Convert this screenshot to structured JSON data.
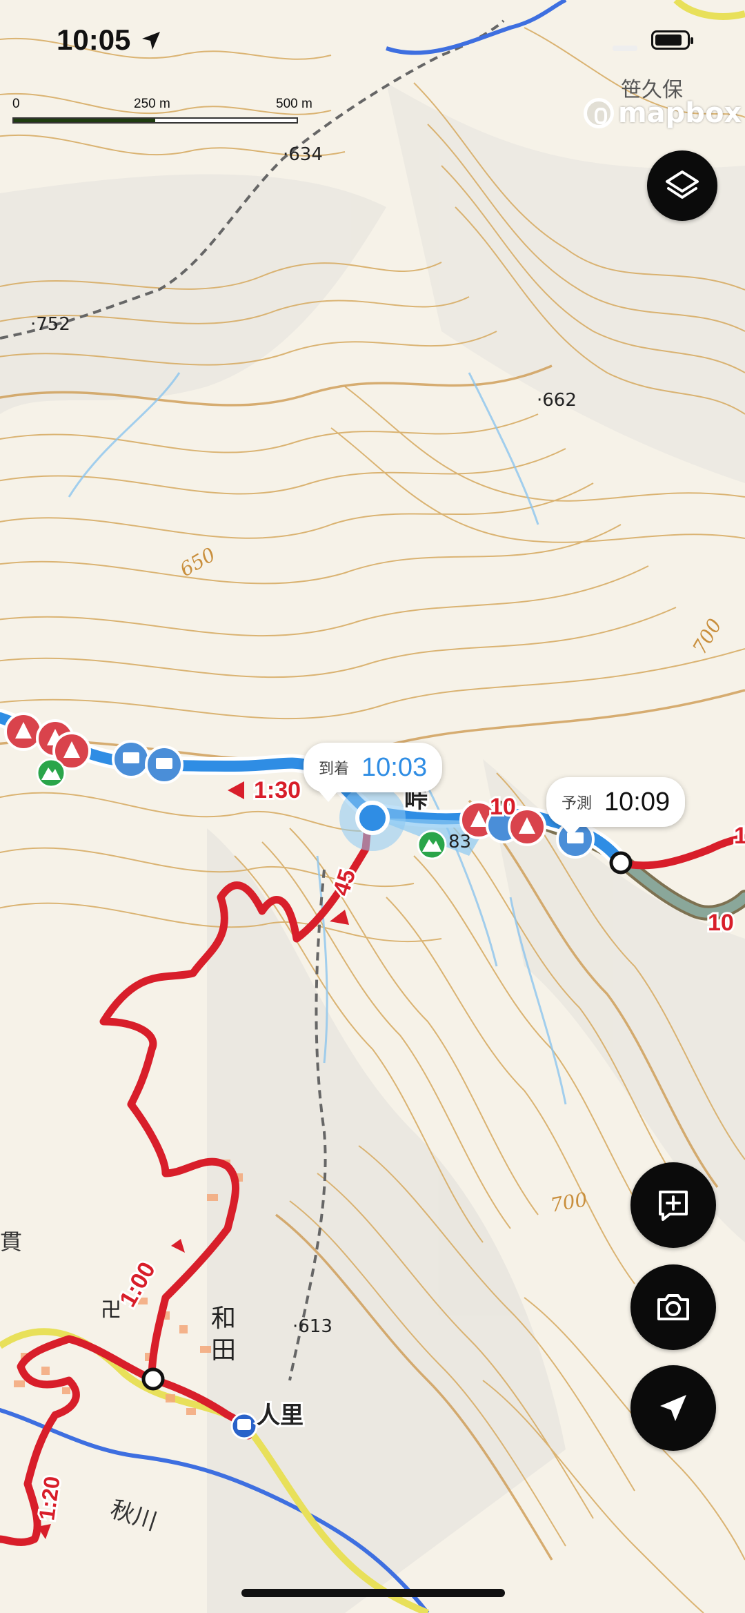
{
  "status_bar": {
    "time": "10:05"
  },
  "scale": {
    "labels": [
      "0",
      "250 m",
      "500 m"
    ]
  },
  "attribution": {
    "logo_text": "mapbox"
  },
  "map": {
    "elevation_labels": [
      "634",
      "752",
      "662",
      "613",
      "83"
    ],
    "contour_labels": [
      "650",
      "700",
      "700"
    ],
    "place_labels": [
      "笹久保",
      "和",
      "田",
      "人里",
      "秋川",
      "貫"
    ],
    "route_times": [
      "1:30",
      "45",
      "1:00",
      "1:20",
      "10",
      "10",
      "1"
    ],
    "colors": {
      "route_red": "#d81e2a",
      "track_blue": "#2f8de4",
      "remaining_track": "#8aa79a",
      "road_yellow": "#e8e05a",
      "contour": "#d6a95e",
      "river": "#3e6fe0",
      "hazard_red": "#d9434c",
      "comment_blue": "#4a8ed8",
      "peak_green": "#2aa54a"
    }
  },
  "current_location": {
    "bubble_label": "到着",
    "bubble_time": "10:03",
    "place_fragment": "峠",
    "accent": "#2f8de4"
  },
  "prediction": {
    "bubble_label": "予測",
    "bubble_time": "10:09"
  },
  "bus_stop": {
    "name": "人里"
  },
  "controls": {
    "layers_icon": "layers-icon",
    "add_note_icon": "add-note-icon",
    "camera_icon": "camera-icon",
    "locate_icon": "location-arrow-icon"
  }
}
